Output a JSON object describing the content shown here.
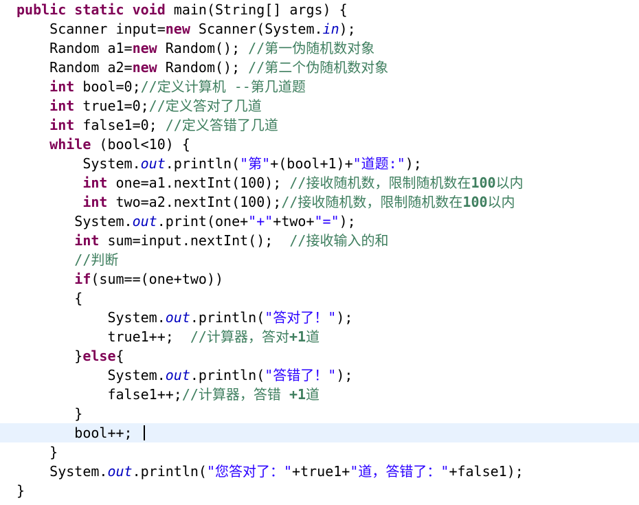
{
  "code": {
    "lines": [
      {
        "t": [
          {
            "k": "kw",
            "v": "public"
          },
          {
            "k": "p",
            "v": " "
          },
          {
            "k": "kw",
            "v": "static"
          },
          {
            "k": "p",
            "v": " "
          },
          {
            "k": "kw",
            "v": "void"
          },
          {
            "k": "p",
            "v": " main(String[] args) {"
          }
        ]
      },
      {
        "t": [
          {
            "k": "p",
            "v": "    Scanner input="
          },
          {
            "k": "kw",
            "v": "new"
          },
          {
            "k": "p",
            "v": " Scanner(System."
          },
          {
            "k": "fld",
            "v": "in"
          },
          {
            "k": "p",
            "v": ");"
          }
        ]
      },
      {
        "t": [
          {
            "k": "p",
            "v": "    Random a1="
          },
          {
            "k": "kw",
            "v": "new"
          },
          {
            "k": "p",
            "v": " Random(); "
          },
          {
            "k": "cm",
            "v": "//第一伪随机数对象"
          }
        ]
      },
      {
        "t": [
          {
            "k": "p",
            "v": "    Random a2="
          },
          {
            "k": "kw",
            "v": "new"
          },
          {
            "k": "p",
            "v": " Random(); "
          },
          {
            "k": "cm",
            "v": "//第二个伪随机数对象"
          }
        ]
      },
      {
        "t": [
          {
            "k": "p",
            "v": "    "
          },
          {
            "k": "kw",
            "v": "int"
          },
          {
            "k": "p",
            "v": " bool=0;"
          },
          {
            "k": "cm",
            "v": "//定义计算机 --第几道题"
          }
        ]
      },
      {
        "t": [
          {
            "k": "p",
            "v": "    "
          },
          {
            "k": "kw",
            "v": "int"
          },
          {
            "k": "p",
            "v": " true1=0;"
          },
          {
            "k": "cm",
            "v": "//定义答对了几道"
          }
        ]
      },
      {
        "t": [
          {
            "k": "p",
            "v": "    "
          },
          {
            "k": "kw",
            "v": "int"
          },
          {
            "k": "p",
            "v": " false1=0; "
          },
          {
            "k": "cm",
            "v": "//定义答错了几道"
          }
        ]
      },
      {
        "t": [
          {
            "k": "p",
            "v": "    "
          },
          {
            "k": "kw",
            "v": "while"
          },
          {
            "k": "p",
            "v": " (bool<10) {"
          }
        ]
      },
      {
        "t": [
          {
            "k": "p",
            "v": "        System."
          },
          {
            "k": "fld",
            "v": "out"
          },
          {
            "k": "p",
            "v": ".println("
          },
          {
            "k": "str",
            "v": "\"第\""
          },
          {
            "k": "p",
            "v": "+(bool+1)+"
          },
          {
            "k": "str",
            "v": "\"道题:\""
          },
          {
            "k": "p",
            "v": ");"
          }
        ]
      },
      {
        "t": [
          {
            "k": "p",
            "v": "        "
          },
          {
            "k": "kw",
            "v": "int"
          },
          {
            "k": "p",
            "v": " one=a1.nextInt(100); "
          },
          {
            "k": "cm",
            "v": "//接收随机数，限制随机数在"
          },
          {
            "k": "cmn",
            "v": "100"
          },
          {
            "k": "cm",
            "v": "以内"
          }
        ]
      },
      {
        "t": [
          {
            "k": "p",
            "v": "        "
          },
          {
            "k": "kw",
            "v": "int"
          },
          {
            "k": "p",
            "v": " two=a2.nextInt(100);"
          },
          {
            "k": "cm",
            "v": "//接收随机数，限制随机数在"
          },
          {
            "k": "cmn",
            "v": "100"
          },
          {
            "k": "cm",
            "v": "以内"
          }
        ]
      },
      {
        "t": [
          {
            "k": "p",
            "v": "       System."
          },
          {
            "k": "fld",
            "v": "out"
          },
          {
            "k": "p",
            "v": ".print(one+"
          },
          {
            "k": "str",
            "v": "\"+\""
          },
          {
            "k": "p",
            "v": "+two+"
          },
          {
            "k": "str",
            "v": "\"=\""
          },
          {
            "k": "p",
            "v": ");"
          }
        ]
      },
      {
        "t": [
          {
            "k": "p",
            "v": "       "
          },
          {
            "k": "kw",
            "v": "int"
          },
          {
            "k": "p",
            "v": " sum=input.nextInt();  "
          },
          {
            "k": "cm",
            "v": "//接收输入的和"
          }
        ]
      },
      {
        "t": [
          {
            "k": "p",
            "v": "       "
          },
          {
            "k": "cm",
            "v": "//判断"
          }
        ]
      },
      {
        "t": [
          {
            "k": "p",
            "v": "       "
          },
          {
            "k": "kw",
            "v": "if"
          },
          {
            "k": "p",
            "v": "(sum==(one+two))"
          }
        ]
      },
      {
        "t": [
          {
            "k": "p",
            "v": "       {"
          }
        ]
      },
      {
        "t": [
          {
            "k": "p",
            "v": "           System."
          },
          {
            "k": "fld",
            "v": "out"
          },
          {
            "k": "p",
            "v": ".println("
          },
          {
            "k": "str",
            "v": "\"答对了！\""
          },
          {
            "k": "p",
            "v": ");"
          }
        ]
      },
      {
        "t": [
          {
            "k": "p",
            "v": "           true1++;  "
          },
          {
            "k": "cm",
            "v": "//计算器，答对"
          },
          {
            "k": "cmn",
            "v": "+1"
          },
          {
            "k": "cm",
            "v": "道"
          }
        ]
      },
      {
        "t": [
          {
            "k": "p",
            "v": "       }"
          },
          {
            "k": "kw",
            "v": "else"
          },
          {
            "k": "p",
            "v": "{"
          }
        ]
      },
      {
        "t": [
          {
            "k": "p",
            "v": "           System."
          },
          {
            "k": "fld",
            "v": "out"
          },
          {
            "k": "p",
            "v": ".println("
          },
          {
            "k": "str",
            "v": "\"答错了！\""
          },
          {
            "k": "p",
            "v": ");"
          }
        ]
      },
      {
        "t": [
          {
            "k": "p",
            "v": "           false1++;"
          },
          {
            "k": "cm",
            "v": "//计算器，答错 "
          },
          {
            "k": "cmn",
            "v": "+1"
          },
          {
            "k": "cm",
            "v": "道"
          }
        ]
      },
      {
        "t": [
          {
            "k": "p",
            "v": "       }"
          }
        ]
      },
      {
        "t": [
          {
            "k": "p",
            "v": "       bool++; "
          }
        ],
        "current": true
      },
      {
        "t": [
          {
            "k": "p",
            "v": "    }"
          }
        ]
      },
      {
        "t": [
          {
            "k": "p",
            "v": "    System."
          },
          {
            "k": "fld",
            "v": "out"
          },
          {
            "k": "p",
            "v": ".println("
          },
          {
            "k": "str",
            "v": "\"您答对了：\""
          },
          {
            "k": "p",
            "v": "+true1+"
          },
          {
            "k": "str",
            "v": "\"道，答错了：\""
          },
          {
            "k": "p",
            "v": "+false1);"
          }
        ]
      },
      {
        "t": [
          {
            "k": "p",
            "v": "}"
          }
        ]
      }
    ]
  },
  "colors": {
    "keyword": "#7f0055",
    "string": "#2a00ff",
    "field": "#0000c0",
    "comment": "#3f7f5f",
    "current_line": "#e8f2fe"
  }
}
